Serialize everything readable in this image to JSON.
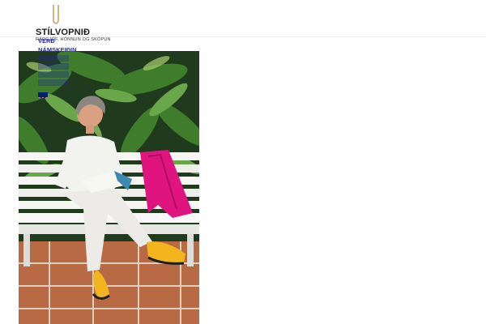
{
  "header": {
    "logo_word": "STÍLVOPNIÐ",
    "logo_tagline": "RÁÐGJÖF, HÖNNUN OG SKÖPUN"
  },
  "nav": {
    "items": [
      {
        "label": "VERÐ"
      },
      {
        "label": "NÁMSKEIÐIN"
      }
    ],
    "language_icon": "uk-flag-icon"
  },
  "colors": {
    "nav_text": "#2b2fa8",
    "logo_accent": "#c8a46a",
    "cardigan": "#e0147f",
    "shoes": "#f2b51d"
  }
}
